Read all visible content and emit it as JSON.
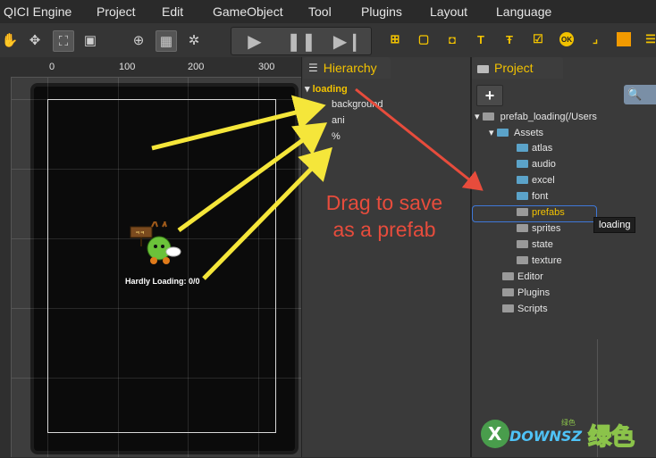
{
  "menubar": {
    "items": [
      "QICI Engine",
      "Project",
      "Edit",
      "GameObject",
      "Tool",
      "Plugins",
      "Layout",
      "Language"
    ]
  },
  "toolbar": {
    "scene_tools": [
      "hand-icon",
      "move-icon",
      "scale-icon",
      "rect-icon",
      "zoom-icon",
      "grid-icon",
      "snap-icon"
    ],
    "play_controls": [
      "play-icon",
      "pause-icon",
      "step-icon"
    ],
    "widget_tools": [
      "node-icon",
      "image-icon",
      "sprite-icon",
      "text-icon",
      "bitmap-text-icon",
      "toggle-icon",
      "button-icon",
      "line-icon",
      "color-rect-icon",
      "menu-icon"
    ]
  },
  "scene": {
    "ruler_ticks": [
      "0",
      "100",
      "200",
      "300"
    ],
    "loading_label": "Hardly Loading: 0/0",
    "sign_text": "ㅋㅋ"
  },
  "hierarchy": {
    "title": "Hierarchy",
    "root": "loading",
    "children": [
      "background",
      "ani",
      "%"
    ]
  },
  "project": {
    "title": "Project",
    "add_label": "+",
    "root": "prefab_loading(/Users",
    "assets_label": "Assets",
    "assets_children": [
      "atlas",
      "audio",
      "excel",
      "font",
      "prefabs",
      "sprites",
      "state",
      "texture"
    ],
    "top_folders": [
      "Editor",
      "Plugins",
      "Scripts"
    ],
    "tooltip": "loading"
  },
  "annotation": {
    "drag_note_line1": "Drag to save",
    "drag_note_line2": "as a prefab"
  },
  "watermark": {
    "text": "DOWNSZ",
    "glyphs": "绿色",
    "small": "绿色"
  },
  "colors": {
    "accent_yellow": "#f2c200",
    "annotation_red": "#e74c3c",
    "arrow_yellow": "#f5e63a",
    "selection_blue": "#3f78d8"
  }
}
